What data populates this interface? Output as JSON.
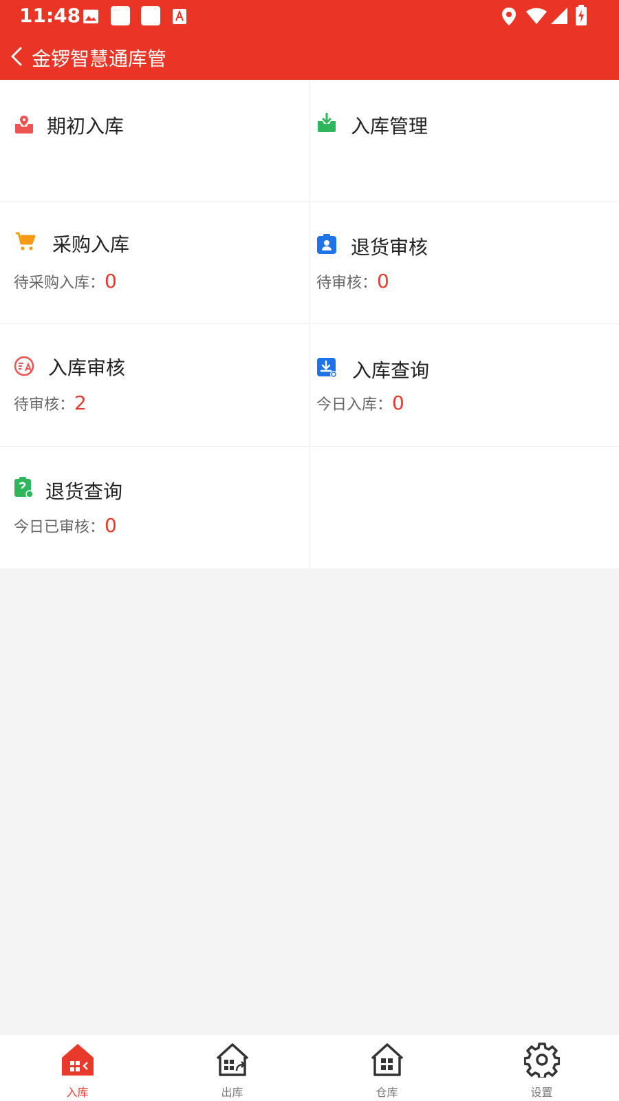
{
  "status_bar": {
    "time": "11:48"
  },
  "app_bar": {
    "title": "金锣智慧通库管"
  },
  "menu": {
    "opening_stock": {
      "label": "期初入库"
    },
    "inbound_management": {
      "label": "入库管理"
    },
    "purchase_inbound": {
      "label": "采购入库",
      "stat_label": "待采购入库：",
      "stat_value": "0"
    },
    "return_review": {
      "label": "退货审核",
      "stat_label": "待审核：",
      "stat_value": "0"
    },
    "inbound_review": {
      "label": "入库审核",
      "stat_label": "待审核：",
      "stat_value": "2"
    },
    "inbound_query": {
      "label": "入库查询",
      "stat_label": "今日入库：",
      "stat_value": "0"
    },
    "return_query": {
      "label": "退货查询",
      "stat_label": "今日已审核：",
      "stat_value": "0"
    }
  },
  "tabs": [
    {
      "label": "入库",
      "icon": "inbound-house-icon",
      "active": true
    },
    {
      "label": "出库",
      "icon": "outbound-house-icon",
      "active": false
    },
    {
      "label": "仓库",
      "icon": "warehouse-house-icon",
      "active": false
    },
    {
      "label": "设置",
      "icon": "gear-icon",
      "active": false
    }
  ],
  "colors": {
    "brand": "#EA3425",
    "number": "#E8392A",
    "green": "#2DB65A",
    "blue": "#1E73E8",
    "orange": "#F59A12"
  }
}
